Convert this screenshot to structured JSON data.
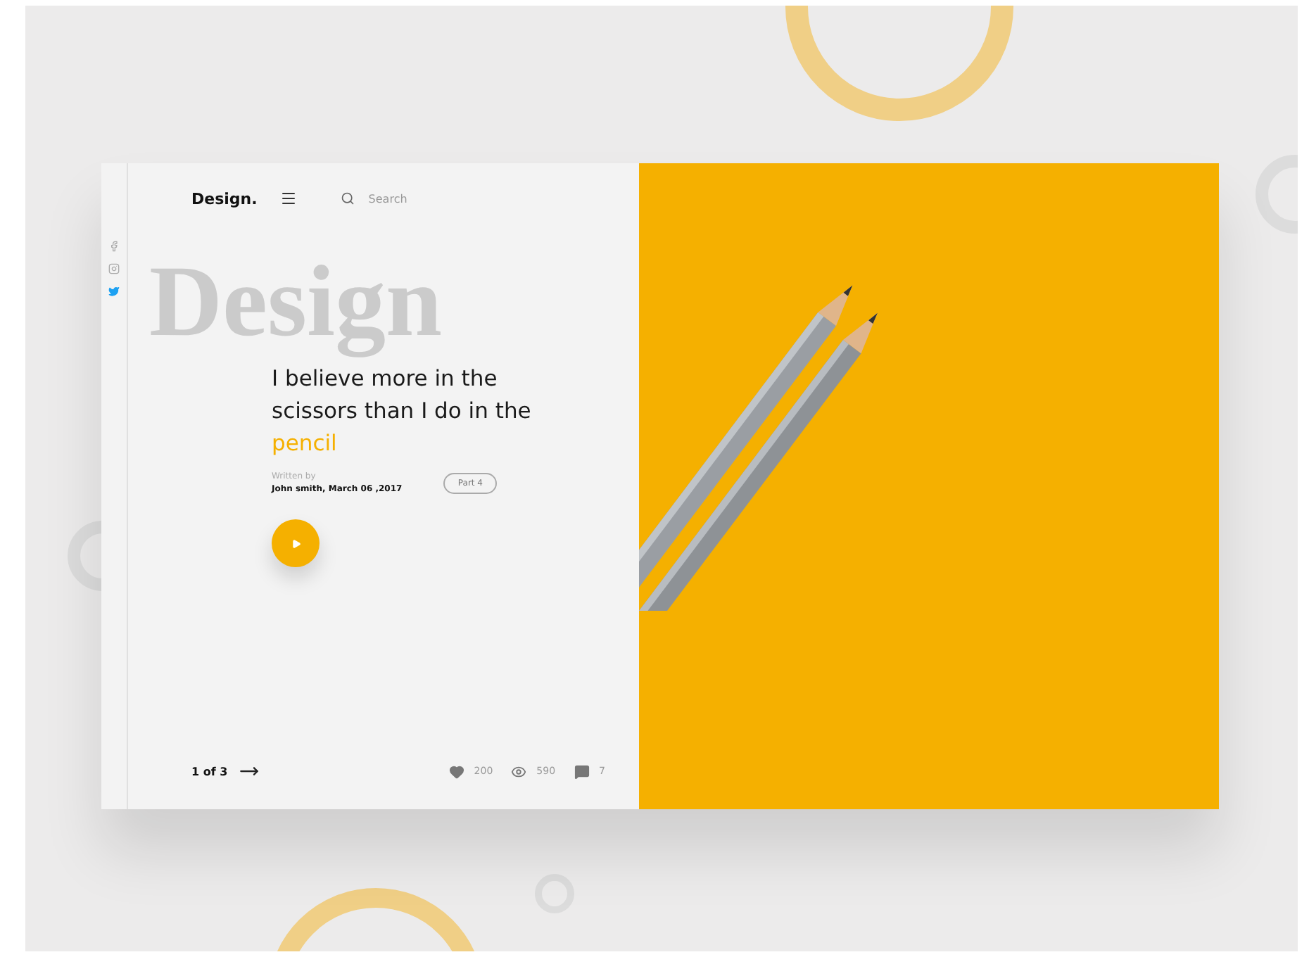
{
  "brand": "Design.",
  "search": {
    "placeholder": "Search"
  },
  "social": [
    {
      "kind": "facebook",
      "selected": false
    },
    {
      "kind": "instagram",
      "selected": false
    },
    {
      "kind": "twitter",
      "selected": true
    }
  ],
  "backdrop_word": "Design",
  "quote": {
    "text": "I believe more in the scissors than I do in the",
    "highlight": "pencil"
  },
  "byline": {
    "label": "Written by",
    "author": "John smith,  March 06 ,2017"
  },
  "part_badge": "Part 4",
  "pager": "1 of 3",
  "stats": [
    {
      "kind": "likes",
      "value": "200"
    },
    {
      "kind": "views",
      "value": "590"
    },
    {
      "kind": "comments",
      "value": "7"
    }
  ]
}
